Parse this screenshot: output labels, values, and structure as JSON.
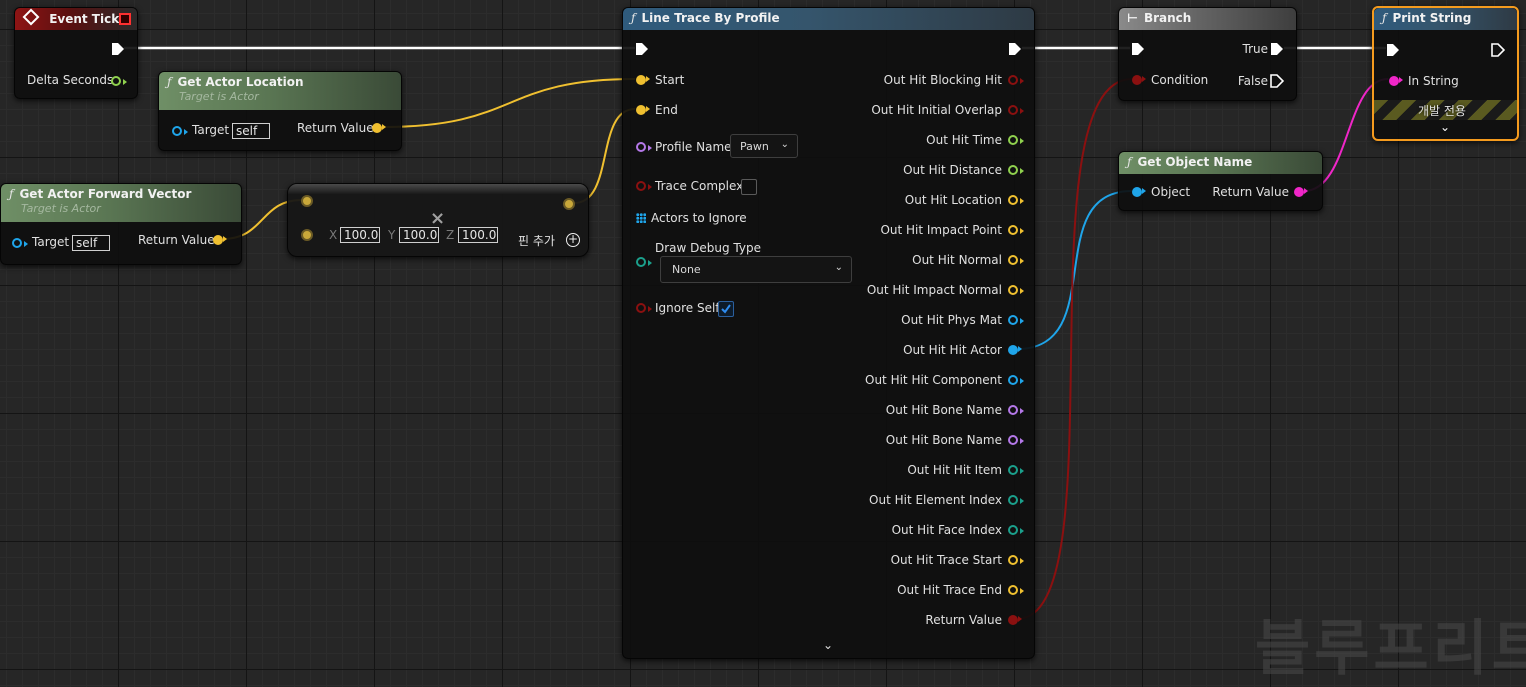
{
  "colors": {
    "exec": "#ffffff",
    "float": "#8fd04e",
    "vector": "#f0c030",
    "object": "#1fa5ea",
    "name": "#b478e8",
    "bool": "#8b1010",
    "string": "#f026c8",
    "struct": "#1ba08c",
    "selection": "#f59b1e"
  },
  "event_tick": {
    "title": "Event Tick",
    "pin_delta": "Delta Seconds"
  },
  "get_actor_location": {
    "title": "Get Actor Location",
    "subtitle": "Target is Actor",
    "target_label": "Target",
    "target_value": "self",
    "return_label": "Return Value"
  },
  "get_actor_forward_vector": {
    "title": "Get Actor Forward Vector",
    "subtitle": "Target is Actor",
    "target_label": "Target",
    "target_value": "self",
    "return_label": "Return Value"
  },
  "multiply_node": {
    "x_label": "X",
    "x_value": "100.0",
    "y_label": "Y",
    "y_value": "100.0",
    "z_label": "Z",
    "z_value": "100.0",
    "add_pin_label": "핀 추가",
    "close_glyph": "×"
  },
  "line_trace": {
    "title": "Line Trace By Profile",
    "inputs": {
      "start": "Start",
      "end": "End",
      "profile_name": "Profile Name",
      "profile_value": "Pawn",
      "trace_complex": "Trace Complex",
      "actors_to_ignore": "Actors to Ignore",
      "draw_debug_type": "Draw Debug Type",
      "draw_debug_value": "None",
      "ignore_self": "Ignore Self"
    },
    "outputs": [
      {
        "label": "Out Hit Blocking Hit",
        "type": "bool"
      },
      {
        "label": "Out Hit Initial Overlap",
        "type": "bool"
      },
      {
        "label": "Out Hit Time",
        "type": "float"
      },
      {
        "label": "Out Hit Distance",
        "type": "float"
      },
      {
        "label": "Out Hit Location",
        "type": "vector"
      },
      {
        "label": "Out Hit Impact Point",
        "type": "vector"
      },
      {
        "label": "Out Hit Normal",
        "type": "vector"
      },
      {
        "label": "Out Hit Impact Normal",
        "type": "vector"
      },
      {
        "label": "Out Hit Phys Mat",
        "type": "object"
      },
      {
        "label": "Out Hit Hit Actor",
        "type": "object",
        "connected": true
      },
      {
        "label": "Out Hit Hit Component",
        "type": "object"
      },
      {
        "label": "Out Hit Bone Name",
        "type": "name"
      },
      {
        "label": "Out Hit Bone Name",
        "type": "name"
      },
      {
        "label": "Out Hit Hit Item",
        "type": "struct"
      },
      {
        "label": "Out Hit Element Index",
        "type": "struct"
      },
      {
        "label": "Out Hit Face Index",
        "type": "struct"
      },
      {
        "label": "Out Hit Trace Start",
        "type": "vector"
      },
      {
        "label": "Out Hit Trace End",
        "type": "vector"
      },
      {
        "label": "Return Value",
        "type": "bool",
        "connected": true
      }
    ]
  },
  "branch": {
    "title": "Branch",
    "condition": "Condition",
    "true_label": "True",
    "false_label": "False"
  },
  "get_object_name": {
    "title": "Get Object Name",
    "object_label": "Object",
    "return_label": "Return Value"
  },
  "print_string": {
    "title": "Print String",
    "in_string": "In String",
    "dev_only": "개발 전용"
  },
  "watermark": "블루프리트"
}
